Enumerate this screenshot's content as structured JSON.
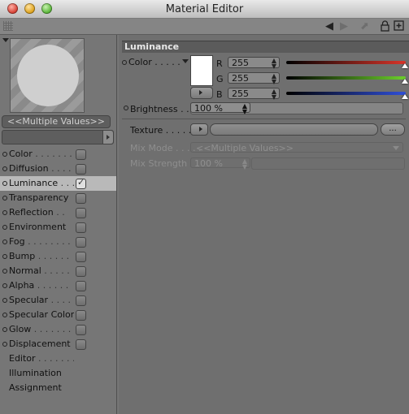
{
  "window": {
    "title": "Material Editor"
  },
  "toolbar": {
    "icons": [
      "grip-icon",
      "back-arrow-icon",
      "forward-arrow-icon",
      "up-arrow-icon",
      "lock-icon",
      "new-window-icon"
    ]
  },
  "preview": {
    "multiple_values_label": "<<Multiple Values>>"
  },
  "channels": [
    {
      "label": "Color",
      "dots": " . . . . . . .",
      "has_dot": true,
      "has_checkbox": true,
      "checked": false,
      "active": false
    },
    {
      "label": "Diffusion",
      "dots": " . . . . .",
      "has_dot": true,
      "has_checkbox": true,
      "checked": false,
      "active": false
    },
    {
      "label": "Luminance",
      "dots": " . . .",
      "has_dot": true,
      "has_checkbox": true,
      "checked": true,
      "active": true
    },
    {
      "label": "Transparency",
      "dots": "",
      "has_dot": true,
      "has_checkbox": true,
      "checked": false,
      "active": false
    },
    {
      "label": "Reflection",
      "dots": " . .",
      "has_dot": true,
      "has_checkbox": true,
      "checked": false,
      "active": false
    },
    {
      "label": "Environment",
      "dots": "",
      "has_dot": true,
      "has_checkbox": true,
      "checked": false,
      "active": false
    },
    {
      "label": "Fog",
      "dots": " . . . . . . . .",
      "has_dot": true,
      "has_checkbox": true,
      "checked": false,
      "active": false
    },
    {
      "label": "Bump",
      "dots": " . . . . . .",
      "has_dot": true,
      "has_checkbox": true,
      "checked": false,
      "active": false
    },
    {
      "label": "Normal",
      "dots": " . . . . .",
      "has_dot": true,
      "has_checkbox": true,
      "checked": false,
      "active": false
    },
    {
      "label": "Alpha",
      "dots": " . . . . . .",
      "has_dot": true,
      "has_checkbox": true,
      "checked": false,
      "active": false
    },
    {
      "label": "Specular",
      "dots": " . . . .",
      "has_dot": true,
      "has_checkbox": true,
      "checked": false,
      "active": false
    },
    {
      "label": "Specular Color",
      "dots": "",
      "has_dot": true,
      "has_checkbox": true,
      "checked": false,
      "active": false
    },
    {
      "label": "Glow",
      "dots": " . . . . . . .",
      "has_dot": true,
      "has_checkbox": true,
      "checked": false,
      "active": false
    },
    {
      "label": "Displacement",
      "dots": "",
      "has_dot": true,
      "has_checkbox": true,
      "checked": false,
      "active": false
    },
    {
      "label": "Editor",
      "dots": " . . . . . . .",
      "has_dot": false,
      "has_checkbox": false,
      "checked": false,
      "active": false
    },
    {
      "label": "Illumination",
      "dots": "",
      "has_dot": false,
      "has_checkbox": false,
      "checked": false,
      "active": false
    },
    {
      "label": "Assignment",
      "dots": "",
      "has_dot": false,
      "has_checkbox": false,
      "checked": false,
      "active": false
    }
  ],
  "luminance": {
    "section_title": "Luminance",
    "color_label": "Color",
    "color_dots": " . . . . .",
    "swatch_color": "#ffffff",
    "r_label": "R",
    "r_value": "255",
    "g_label": "G",
    "g_value": "255",
    "b_label": "B",
    "b_value": "255",
    "brightness_label": "Brightness",
    "brightness_dots": " . . .",
    "brightness_value": "100 %",
    "texture_label": "Texture",
    "texture_dots": " . . . . .",
    "texture_button": "...",
    "mix_mode_label": "Mix Mode",
    "mix_mode_dots": " . . . . .",
    "mix_mode_value": "<<Multiple Values>>",
    "mix_strength_label": "Mix Strength",
    "mix_strength_value": "100 %"
  },
  "colors": {
    "red_slider": "#d8352a",
    "green_slider": "#6cd02c",
    "blue_slider": "#2f4fd8"
  }
}
